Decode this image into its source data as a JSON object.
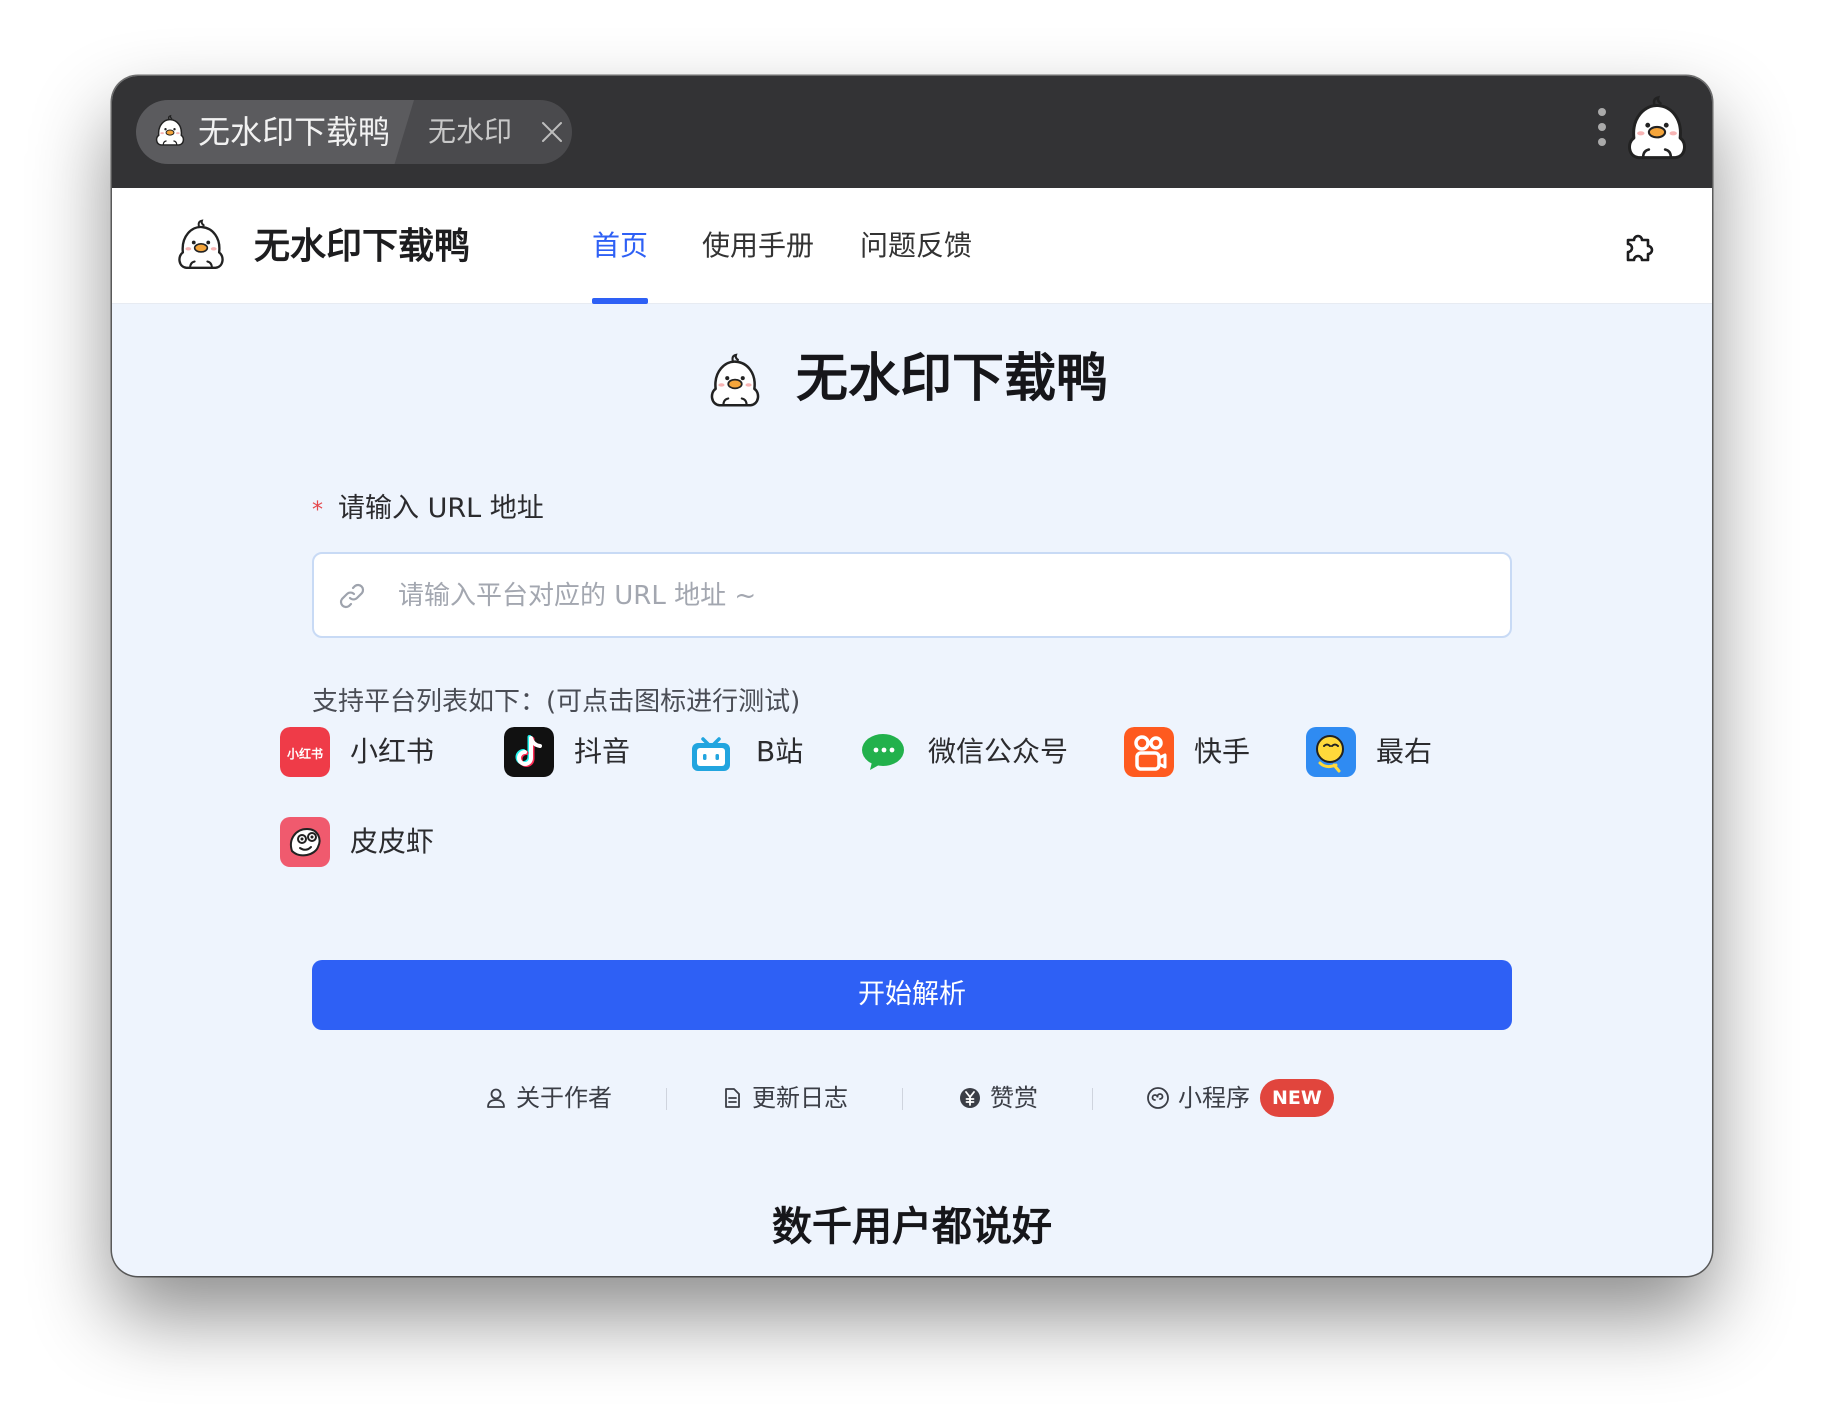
{
  "titlebar": {
    "tab_title": "无水印下载鸭",
    "tab_subtitle": "无水印",
    "icons": [
      "duck-logo",
      "close-icon",
      "more-dots-icon",
      "duck-avatar"
    ]
  },
  "nav": {
    "brand": "无水印下载鸭",
    "links": [
      {
        "label": "首页",
        "active": true
      },
      {
        "label": "使用手册",
        "active": false
      },
      {
        "label": "问题反馈",
        "active": false
      }
    ],
    "extension_icon": "puzzle-icon",
    "accent_color": "#2e60f5"
  },
  "hero": {
    "title": "无水印下载鸭"
  },
  "form": {
    "required_mark": "*",
    "label": "请输入 URL 地址",
    "input_value": "",
    "input_placeholder": "请输入平台对应的 URL 地址 ~",
    "input_icon": "link-icon"
  },
  "platforms": {
    "hint": "支持平台列表如下：(可点击图标进行测试)",
    "items": [
      {
        "label": "小红书",
        "icon": "xiaohongshu-icon",
        "icon_text": "小红书"
      },
      {
        "label": "抖音",
        "icon": "douyin-icon"
      },
      {
        "label": "B站",
        "icon": "bilibili-icon"
      },
      {
        "label": "微信公众号",
        "icon": "wechat-icon"
      },
      {
        "label": "快手",
        "icon": "kuaishou-icon"
      },
      {
        "label": "最右",
        "icon": "zuiyou-icon"
      },
      {
        "label": "皮皮虾",
        "icon": "pipixia-icon"
      }
    ]
  },
  "start_button": "开始解析",
  "footer": {
    "links": [
      {
        "label": "关于作者",
        "icon": "user-icon"
      },
      {
        "label": "更新日志",
        "icon": "document-icon"
      },
      {
        "label": "赞赏",
        "icon": "yen-coin-icon"
      },
      {
        "label": "小程序",
        "icon": "mini-program-icon",
        "badge": "NEW"
      }
    ],
    "badge_color": "#e1453d"
  },
  "section_title": "数千用户都说好"
}
